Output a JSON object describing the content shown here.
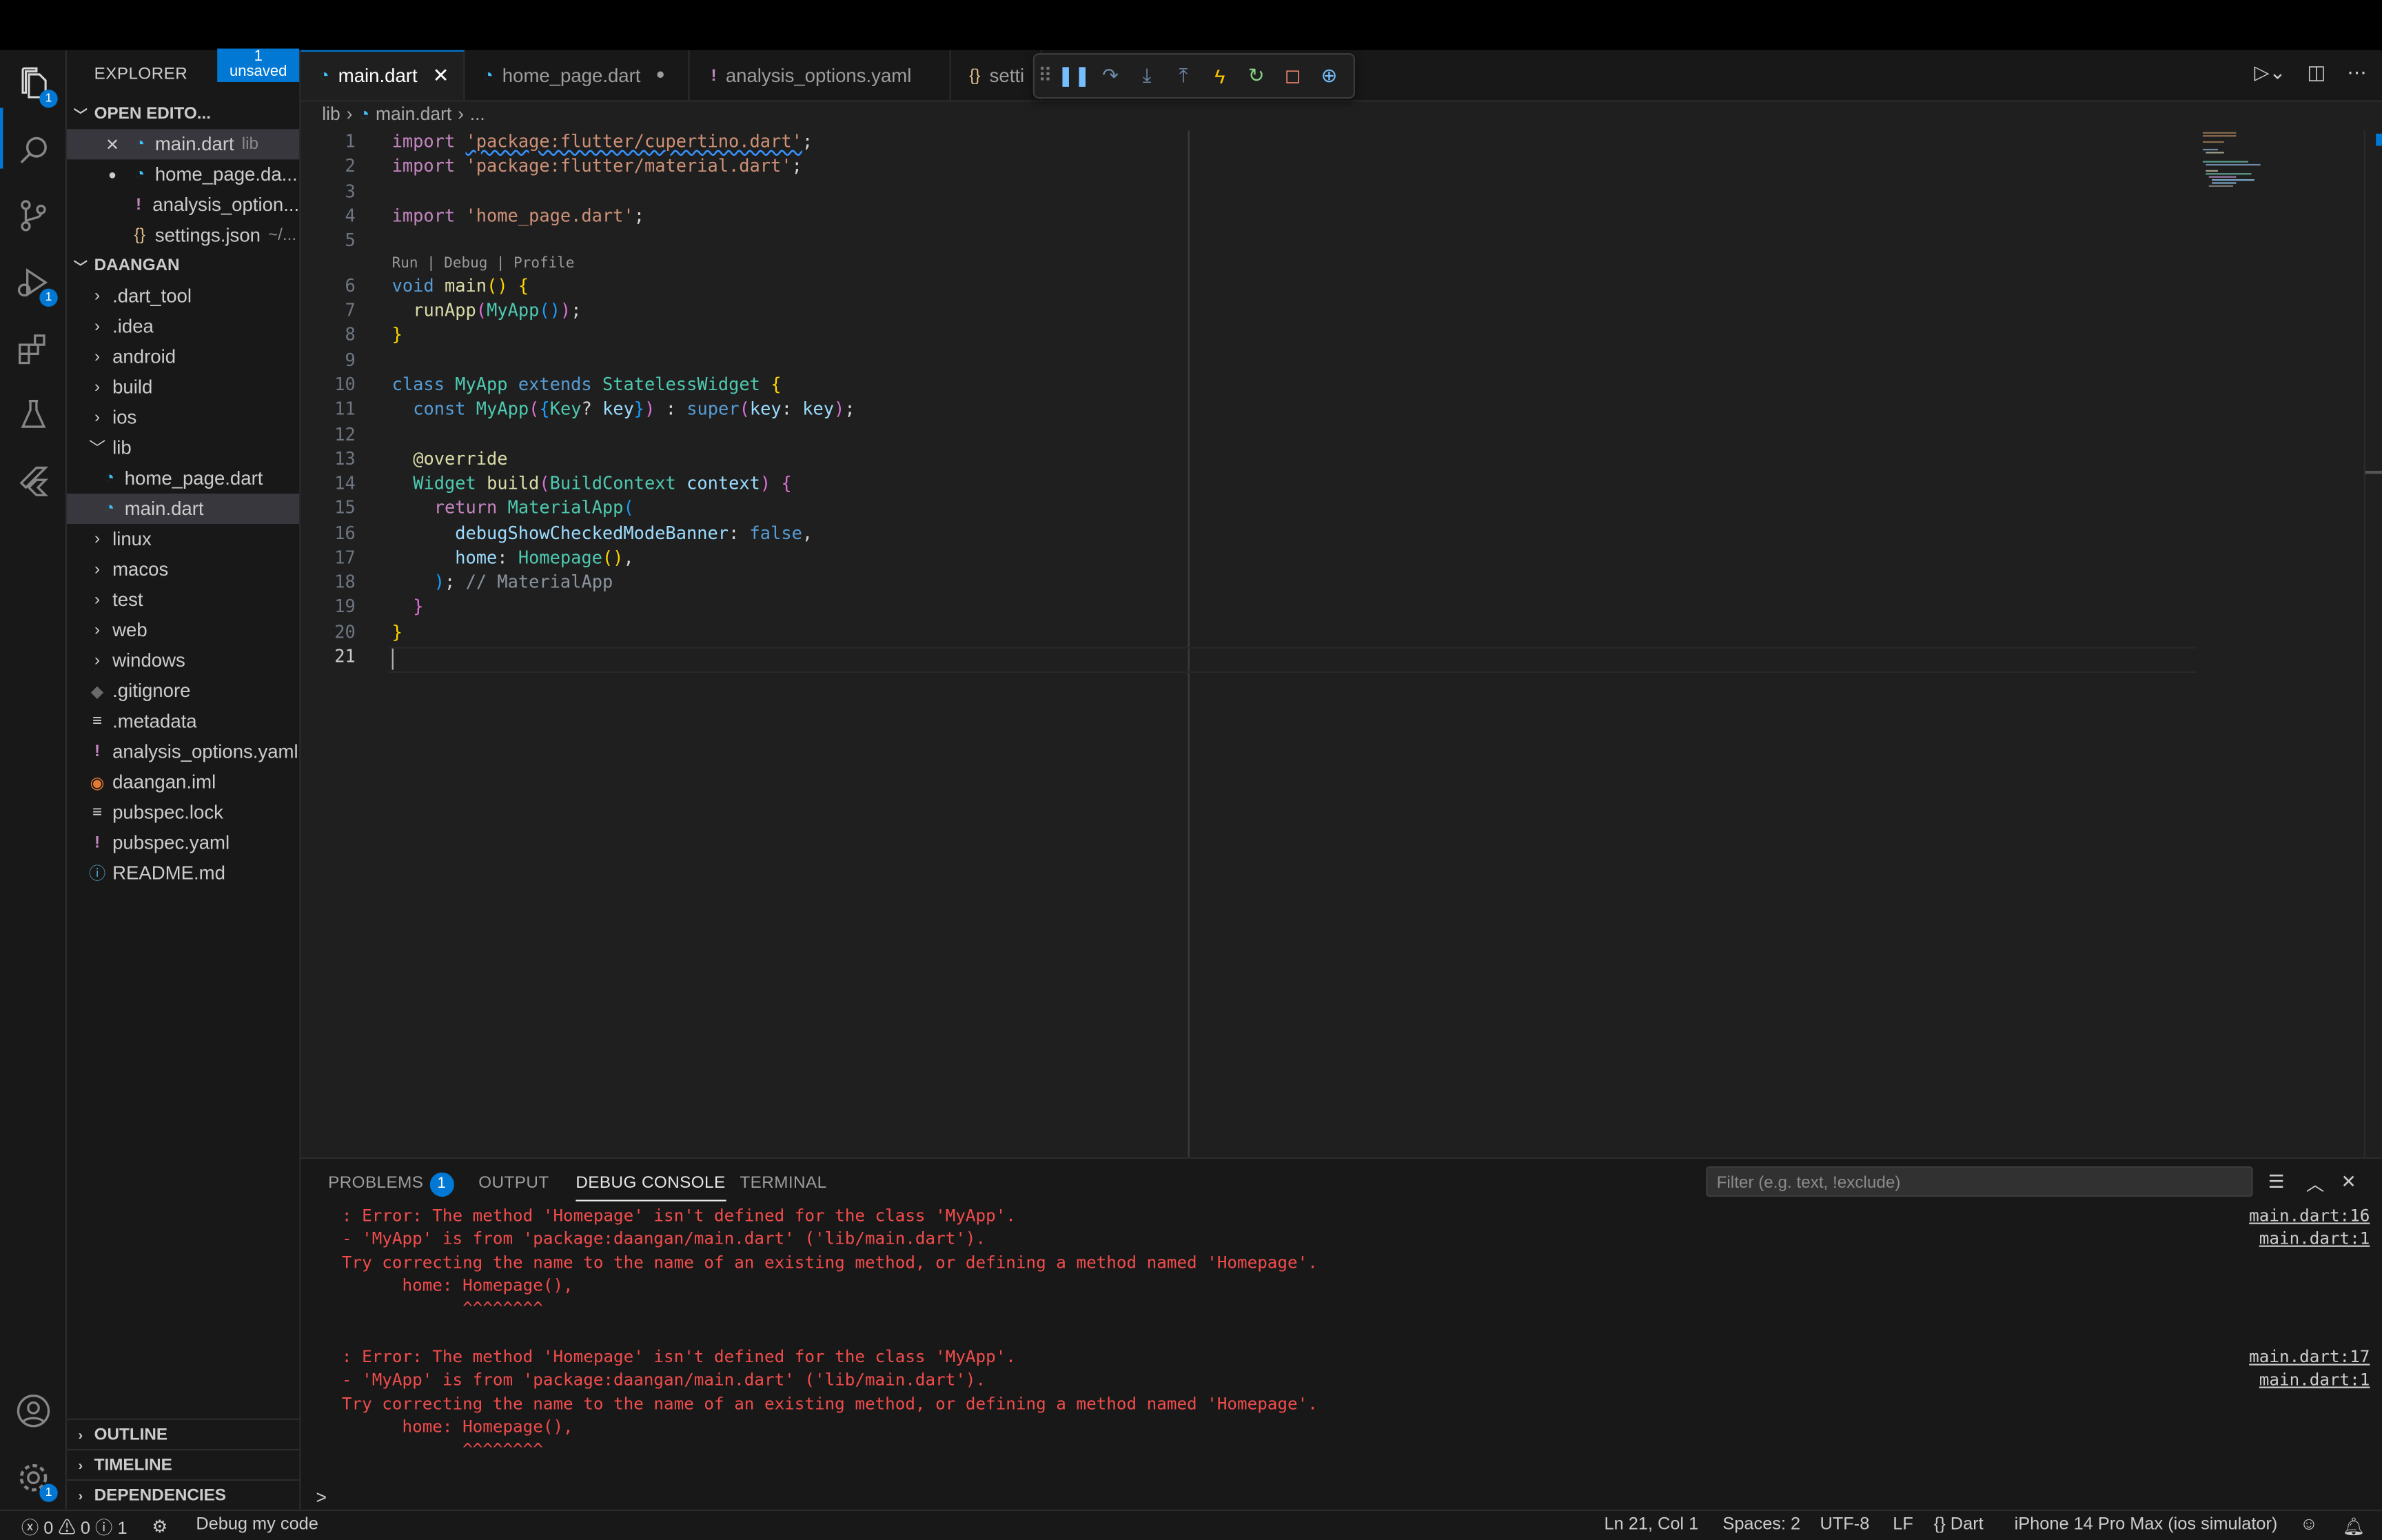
{
  "sidebar": {
    "title": "EXPLORER",
    "more": "···",
    "open_editors": {
      "heading": "OPEN EDITO...",
      "unsaved_count": "1",
      "unsaved_label": "unsaved",
      "items": [
        {
          "name": "main.dart",
          "desc": "lib"
        },
        {
          "name": "home_page.da..."
        },
        {
          "name": "analysis_option..."
        },
        {
          "name": "settings.json",
          "desc": "~/..."
        }
      ]
    },
    "project": {
      "heading": "DAANGAN",
      "items": [
        ".dart_tool",
        ".idea",
        "android",
        "build",
        "ios",
        "lib",
        "home_page.dart",
        "main.dart",
        "linux",
        "macos",
        "test",
        "web",
        "windows",
        ".gitignore",
        ".metadata",
        "analysis_options.yaml",
        "daangan.iml",
        "pubspec.lock",
        "pubspec.yaml",
        "README.md"
      ]
    },
    "sections": [
      "OUTLINE",
      "TIMELINE",
      "DEPENDENCIES"
    ]
  },
  "activity": {
    "explorer_badge": "1",
    "debug_badge": "1",
    "settings_badge": "1"
  },
  "tabs": [
    {
      "label": "main.dart",
      "icon": "dart-icon"
    },
    {
      "label": "home_page.dart",
      "icon": "dart-icon",
      "dirty": "●"
    },
    {
      "label": "analysis_options.yaml",
      "icon": "yaml-icon"
    },
    {
      "label": "setti",
      "icon": "json-icon"
    }
  ],
  "breadcrumb": {
    "folder": "lib",
    "file": "main.dart",
    "more": "..."
  },
  "editor": {
    "line_numbers": [
      "1",
      "2",
      "3",
      "4",
      "5",
      "6",
      "7",
      "8",
      "9",
      "10",
      "11",
      "12",
      "13",
      "14",
      "15",
      "16",
      "17",
      "18",
      "19",
      "20",
      "21"
    ],
    "codelens": "Run | Debug | Profile",
    "lines": {
      "l1": {
        "kw": "import",
        "str": "'package:flutter/cupertino.dart'",
        "end": ";"
      },
      "l2": {
        "kw": "import",
        "str": "'package:flutter/material.dart'",
        "end": ";"
      },
      "l4": {
        "kw": "import",
        "str": "'home_page.dart'",
        "end": ";"
      },
      "l6": {
        "kw": "void",
        "fn": "main",
        "a": "()",
        "b": "{"
      },
      "l7": {
        "fn": "runApp",
        "a": "(",
        "cls": "MyApp",
        "b": "()",
        "c": ")",
        "end": ";"
      },
      "l8": {
        "a": "}"
      },
      "l10": {
        "kw": "class",
        "cls": "MyApp",
        "kw2": "extends",
        "cls2": "StatelessWidget",
        "a": "{"
      },
      "l11": {
        "kw": "const",
        "cls": "MyApp",
        "a": "(",
        "b": "{",
        "cls2": "Key",
        "c": "?",
        "var": "key",
        "d": "}",
        "e": ")",
        "f": " : ",
        "kw2": "super",
        "g": "(",
        "var2": "key",
        "h": ": ",
        "var3": "key",
        "i": ")",
        "end": ";"
      },
      "l13": {
        "a": "@override"
      },
      "l14": {
        "cls": "Widget",
        "fn": "build",
        "a": "(",
        "cls2": "BuildContext",
        "var": "context",
        "b": ")",
        "c": "{"
      },
      "l15": {
        "kw": "return",
        "cls": "MaterialApp",
        "a": "("
      },
      "l16": {
        "var": "debugShowCheckedModeBanner",
        "a": ": ",
        "kw": "false",
        "end": ","
      },
      "l17": {
        "var": "home",
        "a": ": ",
        "cls": "Homepage",
        "b": "()",
        "end": ","
      },
      "l18": {
        "a": ")",
        "end": ";",
        "cmt": "// MaterialApp"
      },
      "l19": {
        "a": "}"
      },
      "l20": {
        "a": "}"
      }
    }
  },
  "panel": {
    "tabs": [
      "PROBLEMS",
      "OUTPUT",
      "DEBUG CONSOLE",
      "TERMINAL"
    ],
    "problems_count": "1",
    "filter_placeholder": "Filter (e.g. text, !exclude)",
    "errors": [
      {
        "lines": [
          ": Error: The method 'Homepage' isn't defined for the class 'MyApp'.",
          "- 'MyApp' is from 'package:daangan/main.dart' ('lib/main.dart').",
          "Try correcting the name to the name of an existing method, or defining a method named 'Homepage'.",
          "      home: Homepage(),",
          "            ^^^^^^^^"
        ],
        "links": [
          "main.dart:16",
          "main.dart:1"
        ]
      },
      {
        "lines": [
          ": Error: The method 'Homepage' isn't defined for the class 'MyApp'.",
          "- 'MyApp' is from 'package:daangan/main.dart' ('lib/main.dart').",
          "Try correcting the name to the name of an existing method, or defining a method named 'Homepage'.",
          "      home: Homepage(),",
          "            ^^^^^^^^"
        ],
        "links": [
          "main.dart:17",
          "main.dart:1"
        ]
      }
    ],
    "prompt": ">"
  },
  "statusbar": {
    "errors": "0",
    "warnings": "0",
    "info": "1",
    "launch": "Debug my code",
    "position": "Ln 21, Col 1",
    "spaces": "Spaces: 2",
    "encoding": "UTF-8",
    "eol": "LF",
    "language_icon": "{}",
    "language": "Dart",
    "device": "iPhone 14 Pro Max (ios simulator)"
  },
  "colors": {
    "accent": "#0078d4",
    "error": "#f14c4c",
    "background": "#1f1f1f"
  }
}
